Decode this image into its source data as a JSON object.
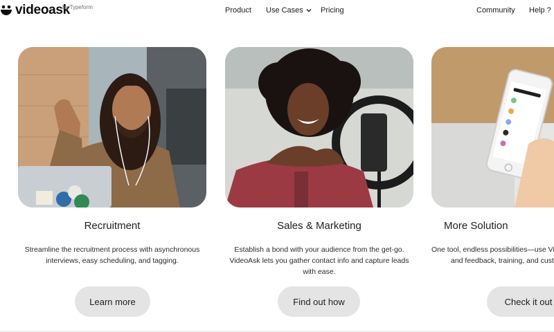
{
  "brand": {
    "name": "videoask",
    "by": "by Typeform"
  },
  "nav": {
    "product": "Product",
    "use_cases": "Use Cases",
    "pricing": "Pricing",
    "community": "Community",
    "help": "Help ?"
  },
  "cards": [
    {
      "title": "Recruitment",
      "desc": [
        "Streamline the recruitment process with asynchronous",
        "interviews, easy scheduling, and tagging."
      ],
      "button": "Learn more"
    },
    {
      "title": "Sales & Marketing",
      "desc": [
        "Establish a bond with your audience from the get-go.",
        "VideoAsk lets you gather contact info and capture leads",
        "with ease."
      ],
      "button": "Find out how"
    },
    {
      "title": "More Solution",
      "desc": [
        "One tool, endless possibilities—use Vi",
        "and feedback, training, and cust"
      ],
      "button": "Check it out"
    }
  ],
  "colors": {
    "button_bg": "#e4e4e4",
    "text": "#1e1e1e",
    "background": "#ffffff"
  }
}
